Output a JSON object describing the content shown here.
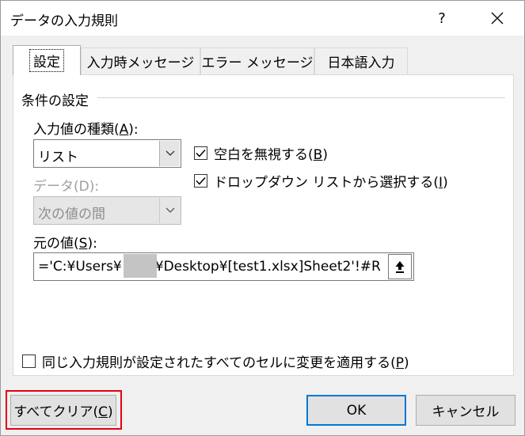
{
  "window": {
    "title": "データの入力規則",
    "help_label": "?"
  },
  "tabs": [
    {
      "label": "設定",
      "active": true
    },
    {
      "label": "入力時メッセージ",
      "active": false
    },
    {
      "label": "エラー メッセージ",
      "active": false
    },
    {
      "label": "日本語入力",
      "active": false
    }
  ],
  "settings": {
    "group_label": "条件の設定",
    "allow": {
      "label": "入力値の種類",
      "mnemonic": "A",
      "value": "リスト"
    },
    "data": {
      "label": "データ(D):",
      "value": "次の値の間"
    },
    "ignore_blank": {
      "label": "空白を無視する",
      "mnemonic": "B",
      "checked": true
    },
    "in_cell_dropdown": {
      "label": "ドロップダウン リストから選択する",
      "mnemonic": "I",
      "checked": true
    },
    "source": {
      "label": "元の値",
      "mnemonic": "S",
      "value_prefix": "='C:¥Users¥",
      "value_suffix": "¥Desktop¥[test1.xlsx]Sheet2'!#R"
    },
    "apply_all": {
      "label": "同じ入力規則が設定されたすべてのセルに変更を適用する",
      "mnemonic": "P",
      "checked": false
    }
  },
  "buttons": {
    "clear_all": {
      "label": "すべてクリア",
      "mnemonic": "C"
    },
    "ok": "OK",
    "cancel": "キャンセル"
  },
  "colors": {
    "highlight": "#e60012",
    "default_button_border": "#0078d7"
  }
}
